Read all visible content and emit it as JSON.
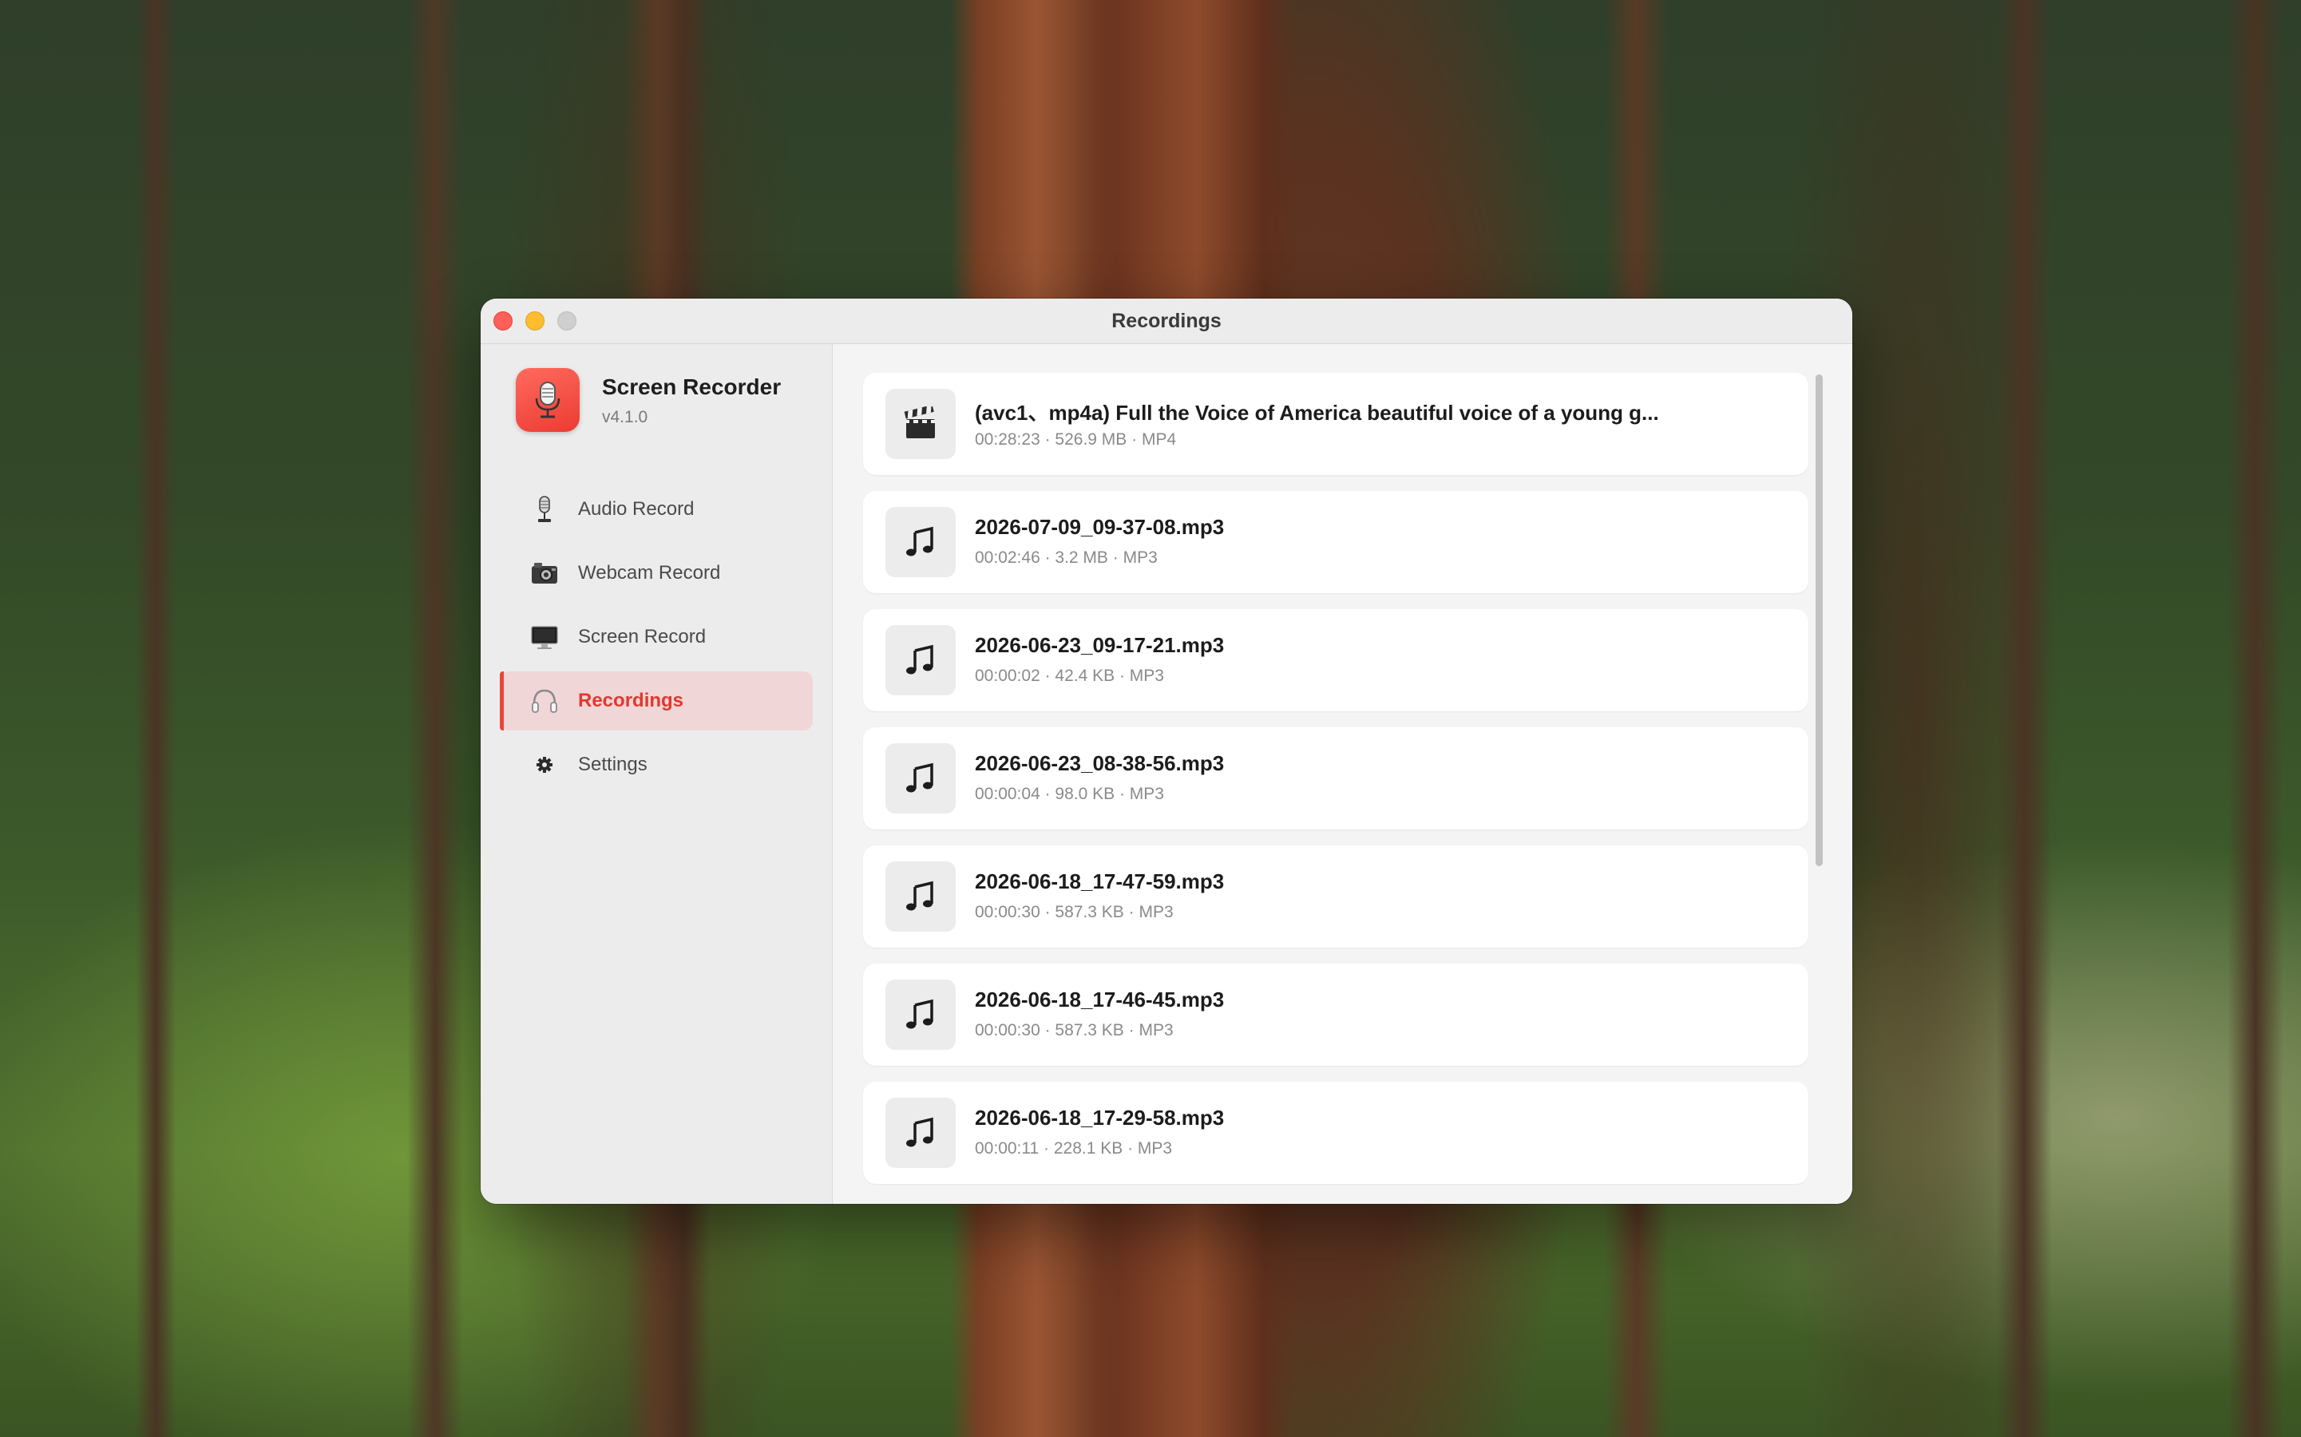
{
  "window": {
    "title": "Recordings"
  },
  "app": {
    "name": "Screen Recorder",
    "version": "v4.1.0"
  },
  "sidebar": {
    "items": [
      {
        "label": "Audio Record",
        "icon": "microphone-icon"
      },
      {
        "label": "Webcam Record",
        "icon": "camera-icon"
      },
      {
        "label": "Screen Record",
        "icon": "monitor-icon"
      },
      {
        "label": "Recordings",
        "icon": "headphones-icon",
        "active": true
      },
      {
        "label": "Settings",
        "icon": "gear-icon"
      }
    ]
  },
  "recordings": [
    {
      "title": "(avc1、mp4a) Full the Voice of America beautiful voice of a young g...",
      "meta": "00:28:23 · 526.9 MB · MP4",
      "icon": "clapperboard-icon"
    },
    {
      "title": "2026-07-09_09-37-08.mp3",
      "meta": "00:02:46 · 3.2 MB · MP3",
      "icon": "music-note-icon"
    },
    {
      "title": "2026-06-23_09-17-21.mp3",
      "meta": "00:00:02 · 42.4 KB · MP3",
      "icon": "music-note-icon"
    },
    {
      "title": "2026-06-23_08-38-56.mp3",
      "meta": "00:00:04 · 98.0 KB · MP3",
      "icon": "music-note-icon"
    },
    {
      "title": "2026-06-18_17-47-59.mp3",
      "meta": "00:00:30 · 587.3 KB · MP3",
      "icon": "music-note-icon"
    },
    {
      "title": "2026-06-18_17-46-45.mp3",
      "meta": "00:00:30 · 587.3 KB · MP3",
      "icon": "music-note-icon"
    },
    {
      "title": "2026-06-18_17-29-58.mp3",
      "meta": "00:00:11 · 228.1 KB · MP3",
      "icon": "music-note-icon"
    }
  ],
  "colors": {
    "accent": "#e0392f",
    "active_bg": "#f0d6d6",
    "close": "#ff5f57",
    "minimize": "#febc2e",
    "maximize": "#cfcfcf"
  }
}
